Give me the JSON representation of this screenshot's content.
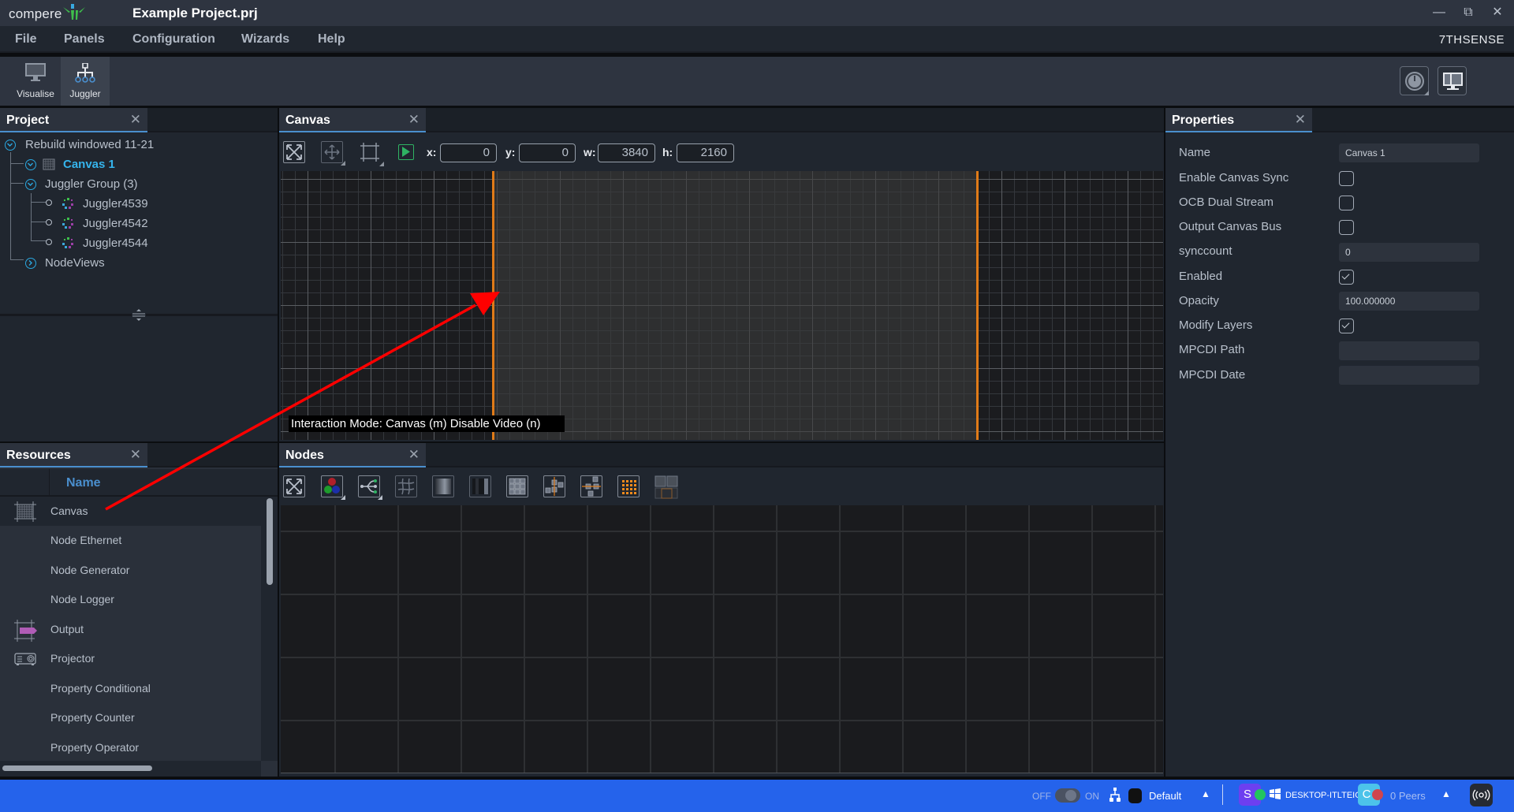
{
  "app": {
    "logo_text": "compere",
    "window_title": "Example Project.prj",
    "brand": "7THSENSE",
    "window_controls": [
      "minimize-icon",
      "restore-icon",
      "close-icon"
    ]
  },
  "menu": [
    "File",
    "Panels",
    "Configuration",
    "Wizards",
    "Help"
  ],
  "toolbar": {
    "modes": [
      {
        "label": "Visualise",
        "icon": "monitor-icon",
        "active": false
      },
      {
        "label": "Juggler",
        "icon": "juggler-network-icon",
        "active": true
      }
    ],
    "right_buttons": [
      "power-icon",
      "display-layout-icon"
    ]
  },
  "project_panel": {
    "title": "Project",
    "tree": [
      {
        "label": "Rebuild windowed 11-21",
        "level": 0,
        "expanded": true
      },
      {
        "label": "Canvas 1",
        "level": 1,
        "expanded": true,
        "selected": true,
        "icon": "canvas-grid-icon"
      },
      {
        "label": "Juggler Group (3)",
        "level": 1,
        "expanded": true
      },
      {
        "label": "Juggler4539",
        "level": 2,
        "icon": "juggler-icon"
      },
      {
        "label": "Juggler4542",
        "level": 2,
        "icon": "juggler-icon"
      },
      {
        "label": "Juggler4544",
        "level": 2,
        "icon": "juggler-icon"
      },
      {
        "label": "NodeViews",
        "level": 1,
        "expanded": false
      }
    ]
  },
  "canvas_panel": {
    "title": "Canvas",
    "fields": {
      "x_label": "x:",
      "x": "0",
      "y_label": "y:",
      "y": "0",
      "w_label": "w:",
      "w": "3840",
      "h_label": "h:",
      "h": "2160"
    },
    "tools": [
      "fit-view-icon",
      "move-icon",
      "crop-icon",
      "play-icon"
    ],
    "status_overlay": "Interaction Mode: Canvas (m) Disable Video (n)",
    "accent_color": "#e07b18"
  },
  "nodes_panel": {
    "title": "Nodes",
    "tools": [
      "fit-view-icon",
      "rgb-icon",
      "splitter-icon",
      "warp-icon",
      "gradient-icon",
      "blend-icon",
      "grid-icon",
      "align-vertical-icon",
      "align-horizontal-icon",
      "dot-matrix-icon",
      "layout-icon"
    ]
  },
  "resources_panel": {
    "title": "Resources",
    "column_header": "Name",
    "items": [
      {
        "label": "Canvas",
        "icon": "canvas-grid-icon"
      },
      {
        "label": "Node Ethernet",
        "icon": ""
      },
      {
        "label": "Node Generator",
        "icon": ""
      },
      {
        "label": "Node Logger",
        "icon": ""
      },
      {
        "label": "Output",
        "icon": "output-icon"
      },
      {
        "label": "Projector",
        "icon": "projector-icon"
      },
      {
        "label": "Property Conditional",
        "icon": ""
      },
      {
        "label": "Property Counter",
        "icon": ""
      },
      {
        "label": "Property Operator",
        "icon": ""
      }
    ]
  },
  "properties_panel": {
    "title": "Properties",
    "rows": [
      {
        "label": "Name",
        "type": "text",
        "value": "Canvas 1"
      },
      {
        "label": "Enable Canvas Sync",
        "type": "checkbox",
        "checked": false
      },
      {
        "label": "OCB Dual Stream",
        "type": "checkbox",
        "checked": false
      },
      {
        "label": "Output Canvas Bus",
        "type": "checkbox",
        "checked": false
      },
      {
        "label": "synccount",
        "type": "text",
        "value": "0"
      },
      {
        "label": "Enabled",
        "type": "checkbox",
        "checked": true
      },
      {
        "label": "Opacity",
        "type": "text",
        "value": "100.000000"
      },
      {
        "label": "Modify Layers",
        "type": "checkbox",
        "checked": true
      },
      {
        "label": "MPCDI Path",
        "type": "text",
        "value": ""
      },
      {
        "label": "MPCDI Date",
        "type": "text",
        "value": ""
      }
    ]
  },
  "statusbar": {
    "toggle_off": "OFF",
    "toggle_on": "ON",
    "profile": "Default",
    "server_badge": "S",
    "hostname": "DESKTOP-ITLTEIG",
    "client_badge": "C",
    "peers": "0 Peers",
    "colors": {
      "bar": "#2563eb",
      "server": "#6d3ff0",
      "client": "#4cc3ea",
      "online": "#22c55e",
      "offline": "#d0454f"
    }
  },
  "annotation": {
    "type": "arrow",
    "color": "#ff0000",
    "from": "resources-canvas-item",
    "to": "canvas-left-edge"
  }
}
